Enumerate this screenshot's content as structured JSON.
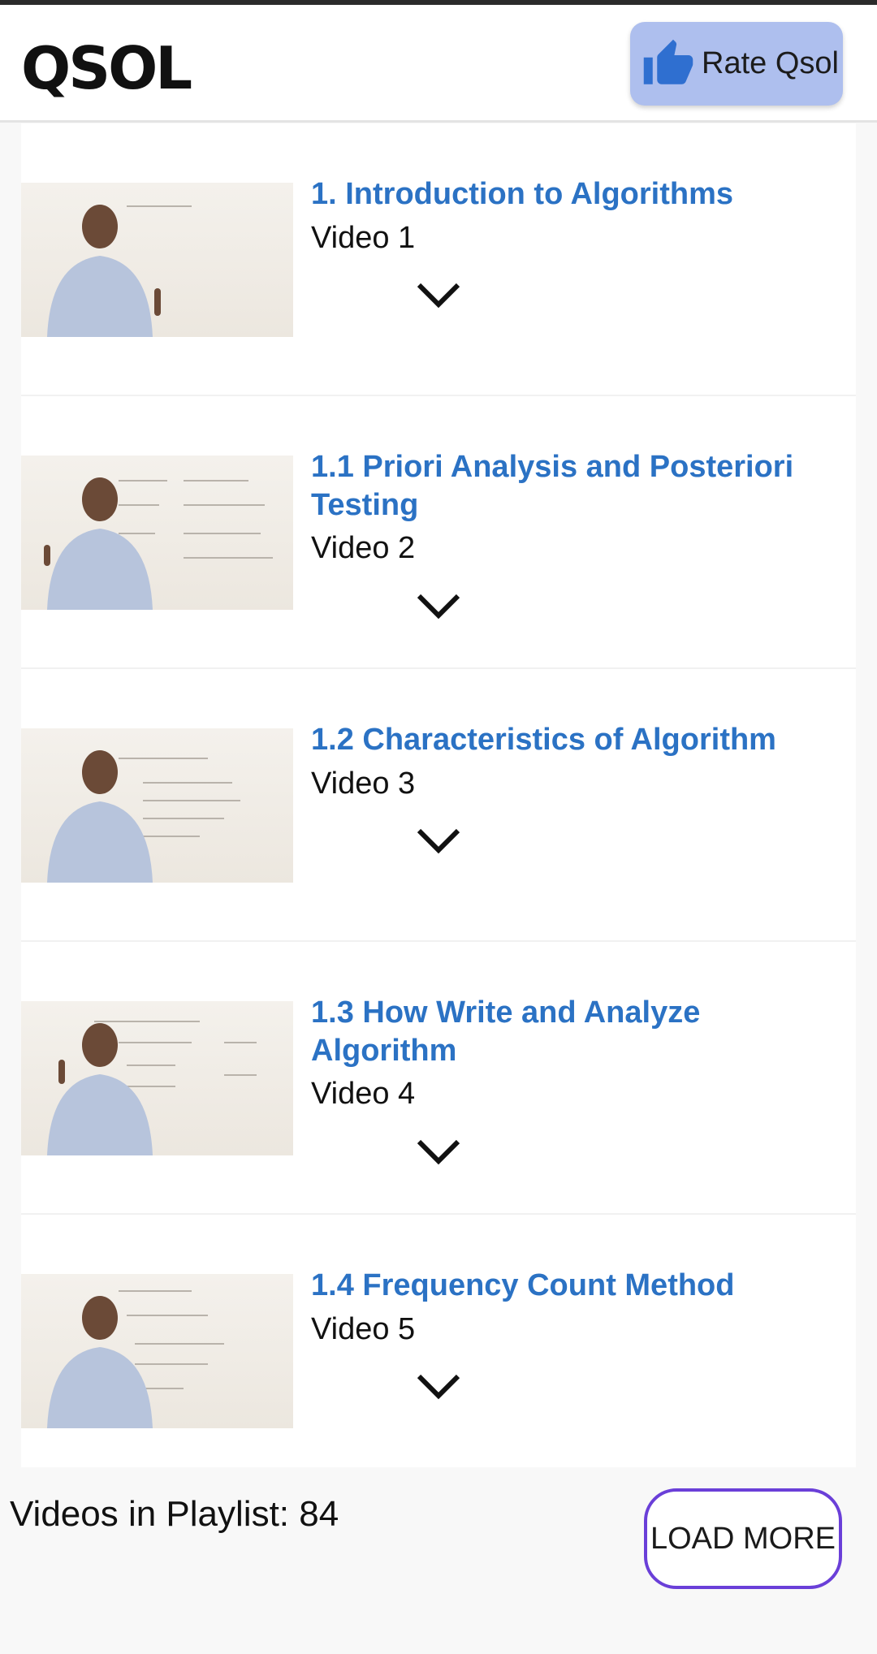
{
  "header": {
    "logo_text": "QSOL",
    "rate_button_label": "Rate Qsol",
    "rate_icon": "thumbs-up-icon",
    "rate_button_color": "#aebfee"
  },
  "playlist": {
    "items": [
      {
        "title": "1. Introduction to Algorithms",
        "subtitle": "Video 1"
      },
      {
        "title": "1.1 Priori Analysis and Posteriori Testing",
        "subtitle": "Video 2"
      },
      {
        "title": "1.2 Characteristics of Algorithm",
        "subtitle": "Video 3"
      },
      {
        "title": "1.3 How Write and Analyze Algorithm",
        "subtitle": "Video 4"
      },
      {
        "title": "1.4 Frequency Count Method",
        "subtitle": "Video 5"
      }
    ],
    "expand_icon": "chevron-down-icon",
    "title_color": "#2b72c4"
  },
  "footer": {
    "count_text": "Videos in Playlist: 84",
    "load_more_label": "LOAD MORE",
    "load_more_border_color": "#6a3fd8"
  }
}
